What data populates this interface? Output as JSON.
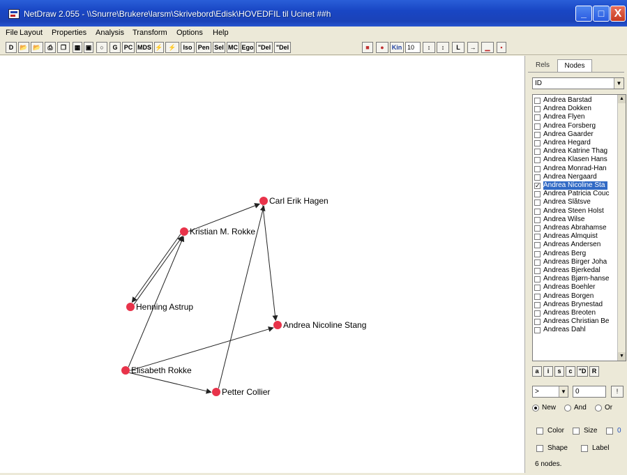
{
  "window": {
    "title": "NetDraw 2.055 - \\\\Snurre\\Brukere\\larsm\\Skrivebord\\Edisk\\HOVEDFIL til Ucinet ##h",
    "min_label": "_",
    "max_label": "□",
    "close_label": "X"
  },
  "menu": {
    "items": [
      "File",
      "Layout",
      "Properties",
      "Analysis",
      "Transform",
      "Options",
      "Help"
    ]
  },
  "toolbar": {
    "buttons": [
      "D",
      "",
      "",
      "",
      "",
      "",
      "",
      "",
      "G",
      "PC",
      "MDS",
      "",
      "",
      "Iso",
      "Pen",
      "Sel",
      "MC",
      "Ego",
      "\"Del",
      "\"Del",
      "",
      "",
      "Kin"
    ],
    "size_value": "10",
    "tail_buttons": [
      "",
      "",
      "L",
      "",
      "",
      ""
    ]
  },
  "graph": {
    "nodes": [
      {
        "id": "carl",
        "label": "Carl Erik Hagen"
      },
      {
        "id": "kristian",
        "label": "Kristian M. Rokke"
      },
      {
        "id": "henning",
        "label": "Henning Astrup"
      },
      {
        "id": "andrea",
        "label": "Andrea Nicoline Stang"
      },
      {
        "id": "elisabeth",
        "label": "Elisabeth Rokke"
      },
      {
        "id": "petter",
        "label": "Petter Collier"
      }
    ],
    "edges": [
      [
        "kristian",
        "carl"
      ],
      [
        "kristian",
        "henning"
      ],
      [
        "henning",
        "kristian"
      ],
      [
        "elisabeth",
        "kristian"
      ],
      [
        "carl",
        "andrea"
      ],
      [
        "petter",
        "carl"
      ],
      [
        "elisabeth",
        "andrea"
      ],
      [
        "elisabeth",
        "petter"
      ]
    ],
    "node_color": "#e8334a"
  },
  "panel": {
    "tab_rels": "Rels",
    "tab_nodes": "Nodes",
    "attribute_select": "ID",
    "list": [
      {
        "name": "Andrea Barstad",
        "checked": false
      },
      {
        "name": "Andrea Dokken",
        "checked": false
      },
      {
        "name": "Andrea Flyen",
        "checked": false
      },
      {
        "name": "Andrea Forsberg",
        "checked": false
      },
      {
        "name": "Andrea Gaarder",
        "checked": false
      },
      {
        "name": "Andrea Hegard",
        "checked": false
      },
      {
        "name": "Andrea Katrine Thag",
        "checked": false
      },
      {
        "name": "Andrea Klasen Hans",
        "checked": false
      },
      {
        "name": "Andrea Monrad-Han",
        "checked": false
      },
      {
        "name": "Andrea Nergaard",
        "checked": false
      },
      {
        "name": "Andrea Nicoline Sta",
        "checked": true,
        "selected": true
      },
      {
        "name": "Andrea Patricia Couc",
        "checked": false
      },
      {
        "name": "Andrea Slåtsve",
        "checked": false
      },
      {
        "name": "Andrea Steen Holst",
        "checked": false
      },
      {
        "name": "Andrea Wilse",
        "checked": false
      },
      {
        "name": "Andreas Abrahamse",
        "checked": false
      },
      {
        "name": "Andreas Almquist",
        "checked": false
      },
      {
        "name": "Andreas Andersen",
        "checked": false
      },
      {
        "name": "Andreas Berg",
        "checked": false
      },
      {
        "name": "Andreas Birger Joha",
        "checked": false
      },
      {
        "name": "Andreas Bjerkedal",
        "checked": false
      },
      {
        "name": "Andreas Bjørn-hanse",
        "checked": false
      },
      {
        "name": "Andreas Boehler",
        "checked": false
      },
      {
        "name": "Andreas Borgen",
        "checked": false
      },
      {
        "name": "Andreas Brynestad",
        "checked": false
      },
      {
        "name": "Andreas Breoten",
        "checked": false
      },
      {
        "name": "Andreas Christian Be",
        "checked": false
      },
      {
        "name": "Andreas Dahl",
        "checked": false
      }
    ],
    "mini_buttons": [
      "a",
      "i",
      "s",
      "c",
      "\"D",
      "R"
    ],
    "operator": ">",
    "value": "0",
    "go_label": "!",
    "radio_new": "New",
    "radio_and": "And",
    "radio_or": "Or",
    "chk_color": "Color",
    "chk_size": "Size",
    "chk_third": "0",
    "chk_shape": "Shape",
    "chk_label": "Label",
    "status": "6 nodes."
  }
}
